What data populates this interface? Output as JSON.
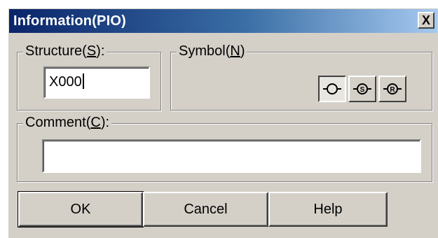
{
  "dialog": {
    "title": "Information(PIO)",
    "close_label": "X"
  },
  "structure": {
    "label_before": "Structure(",
    "label_key": "S",
    "label_after": "):",
    "value": "X000"
  },
  "symbol": {
    "label_before": "Symbol(",
    "label_key": "N",
    "label_after": ")",
    "buttons": [
      {
        "name": "coil",
        "letter": "",
        "selected": true
      },
      {
        "name": "set-coil",
        "letter": "S",
        "selected": false
      },
      {
        "name": "reset-coil",
        "letter": "R",
        "selected": false
      }
    ]
  },
  "comment": {
    "label_before": "Comment(",
    "label_key": "C",
    "label_after": "):",
    "value": ""
  },
  "buttons": {
    "ok": "OK",
    "cancel": "Cancel",
    "help": "Help"
  }
}
